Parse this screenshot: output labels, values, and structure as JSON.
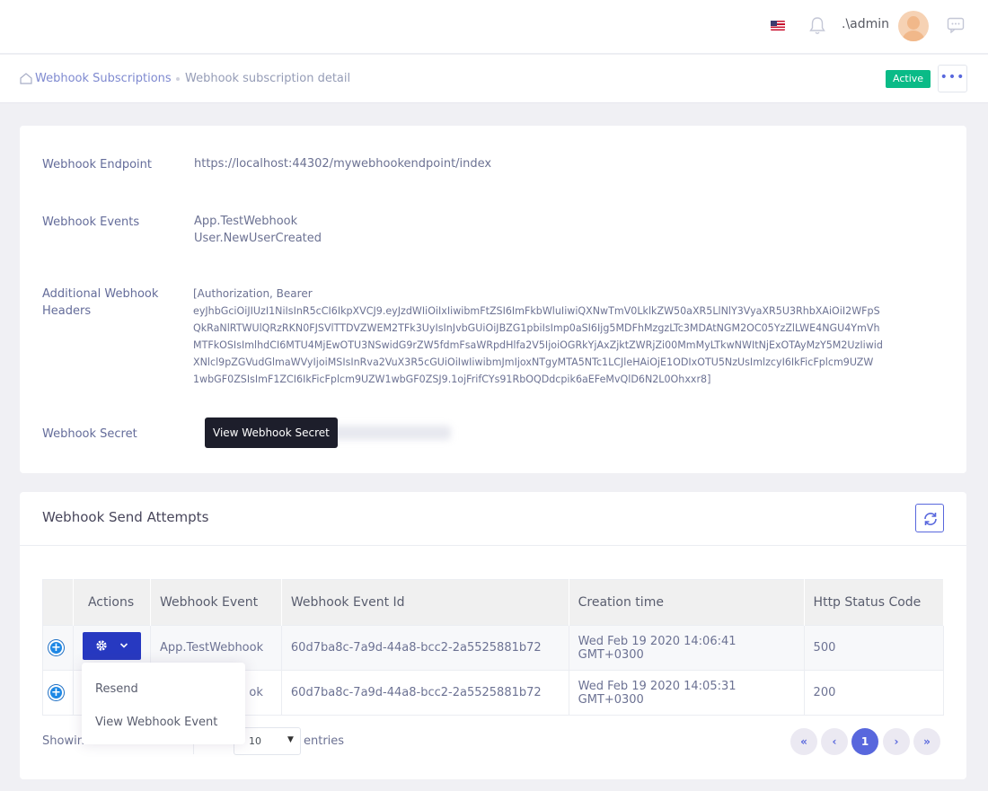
{
  "header": {
    "username": ".\\admin",
    "flag_icon": "us-flag-icon",
    "notification_icon": "bell-icon",
    "chat_icon": "chat-icon"
  },
  "subheader": {
    "breadcrumb_root": "Webhook Subscriptions",
    "breadcrumb_current": "Webhook subscription detail",
    "status_badge": "Active",
    "more_button": "•••"
  },
  "detail": {
    "endpoint_label": "Webhook Endpoint",
    "endpoint_value": "https://localhost:44302/mywebhookendpoint/index",
    "events_label": "Webhook Events",
    "events": [
      "App.TestWebhook",
      "User.NewUserCreated"
    ],
    "headers_label_line1": "Additional Webhook",
    "headers_label_line2": "Headers",
    "headers_lines": [
      "[Authorization, Bearer",
      "eyJhbGciOiJIUzI1NiIsInR5cCI6IkpXVCJ9.eyJzdWIiOiIxIiwibmFtZSI6ImFkbWluIiwiQXNwTmV0LklkZW50aXR5LlNlY3VyaXR5U3RhbXAiOiI2WFpS",
      "QkRaNlRTWUlQRzRKN0FJSVlTTDVZWEM2TFk3UyIsInJvbGUiOiJBZG1pbiIsImp0aSI6Ijg5MDFhMzgzLTc3MDAtNGM2OC05YzZlLWE4NGU4YmVh",
      "MTFkOSIsImlhdCI6MTU4MjEwOTU3NSwidG9rZW5fdmFsaWRpdHlfa2V5IjoiOGRkYjAxZjktZWRjZi00MmMyLTkwNWItNjExOTAyMzY5M2UzIiwid",
      "XNlcl9pZGVudGlmaWVyIjoiMSIsInRva2VuX3R5cGUiOiIwIiwibmJmIjoxNTgyMTA5NTc1LCJleHAiOjE1ODIxOTU5NzUsImlzcyI6IkFicFplcm9UZW",
      "1wbGF0ZSIsImF1ZCI6IkFicFplcm9UZW1wbGF0ZSJ9.1ojFrifCYs91RbOQDdcpik6aEFeMvQlD6N2L0Ohxxr8]"
    ],
    "secret_label": "Webhook Secret",
    "secret_tooltip": "View Webhook Secret"
  },
  "attempts": {
    "title": "Webhook Send Attempts",
    "refresh_icon": "refresh-icon",
    "columns": [
      "",
      "Actions",
      "Webhook Event",
      "Webhook Event Id",
      "Creation time",
      "Http Status Code"
    ],
    "rows": [
      {
        "event": "App.TestWebhook",
        "event_id": "60d7ba8c-7a9d-44a8-bcc2-2a5525881b72",
        "created": "Wed Feb 19 2020 14:06:41 GMT+0300",
        "status": "500"
      },
      {
        "event": "ok",
        "event_id": "60d7ba8c-7a9d-44a8-bcc2-2a5525881b72",
        "created": "Wed Feb 19 2020 14:05:31 GMT+0300",
        "status": "200"
      }
    ],
    "expand_symbol": "+",
    "dropdown": {
      "resend": "Resend",
      "view_event": "View Webhook Event"
    },
    "footer_show": "Showin",
    "page_size": "10",
    "entries_label": "entries",
    "pagination": {
      "first": "«",
      "prev": "‹",
      "current": "1",
      "next": "›",
      "last": "»"
    }
  }
}
